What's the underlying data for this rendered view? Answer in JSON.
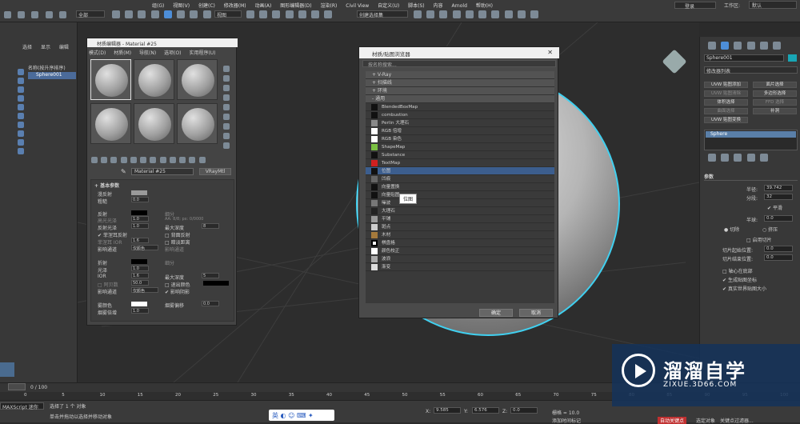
{
  "menubar": {
    "items": [
      "组(G)",
      "视图(V)",
      "创建(C)",
      "修改器(M)",
      "动画(A)",
      "图形编辑器(D)",
      "渲染(R)",
      "Civil View",
      "自定义(U)",
      "脚本(S)",
      "内容",
      "Arnold",
      "帮助(H)"
    ],
    "login": "登录",
    "workspace_label": "工作区:",
    "workspace_value": "默认"
  },
  "toolbar": {
    "filter": "全部",
    "viewmode": "视图",
    "selection_set": "创建选择集"
  },
  "leftpanel": {
    "tabs": [
      "选择",
      "显示",
      "编辑"
    ],
    "tree_header": "名称(按升序排序)",
    "tree_item": "Sphere001"
  },
  "material_editor": {
    "title": "材质编辑器 - Material #25",
    "menu": [
      "模式(D)",
      "材质(M)",
      "导航(N)",
      "选项(O)",
      "实用程序(U)"
    ],
    "material_name": "Material #25",
    "material_type": "VRayMtl",
    "section_basic": "基本参数",
    "rows": [
      {
        "label": "漫反射",
        "value": ""
      },
      {
        "label": "粗糙",
        "value": "0.0"
      },
      {
        "label": "反射",
        "value": ""
      },
      {
        "label": "高光光泽",
        "value": "1.0"
      },
      {
        "label": "反射光泽",
        "value": "1.0"
      },
      {
        "label": "菲涅耳反射",
        "value": ""
      },
      {
        "label": "菲涅耳 IOR",
        "value": "1.6"
      },
      {
        "label": "影响通道",
        "value": "仅颜色"
      },
      {
        "label": "折射",
        "value": ""
      },
      {
        "label": "光泽",
        "value": "1.0"
      },
      {
        "label": "IOR",
        "value": "1.6"
      },
      {
        "label": "阿贝数",
        "value": "50.0"
      },
      {
        "label": "影响通道",
        "value": "仅颜色"
      },
      {
        "label": "雾颜色",
        "value": ""
      },
      {
        "label": "烟雾倍增",
        "value": "1.0"
      }
    ],
    "right_labels": [
      "细分",
      "AA: 8/8; px: 0/0000",
      "最大深度",
      "背面反射",
      "暗淡距离",
      "影响通道",
      "细分",
      "最大深度",
      "退出颜色",
      "影响阴影",
      "烟雾偏移"
    ],
    "right_values": [
      "8",
      "5",
      "5",
      "0.0"
    ]
  },
  "browser": {
    "title": "材质/贴图浏览器",
    "search_placeholder": "按名称搜索...",
    "categories": [
      "+ V-Ray",
      "+ 扫描线",
      "+ 环境",
      "- 通用"
    ],
    "items": [
      "BlendedBoxMap",
      "combustion",
      "Perlin 大理石",
      "RGB 倍增",
      "RGB 染色",
      "ShapeMap",
      "Substance",
      "TextMap",
      "位图",
      "凹痕",
      "向量置换",
      "向量贴图",
      "噪波",
      "大理石",
      "平铺",
      "斑点",
      "木材",
      "棋盘格",
      "颜色校正",
      "波浪",
      "渐变"
    ],
    "selected_index": 8,
    "tooltip": "位图",
    "ok": "确定",
    "cancel": "取消"
  },
  "rightpanel": {
    "object_name": "Sphere001",
    "modifier_list": "修改器列表",
    "buttons": [
      "UVW 贴图添加",
      "面片选择",
      "UVW 贴图清除",
      "多边形选择",
      "体积选择",
      "FFD 选择",
      "曲面选择",
      "补洞",
      "UVW 贴图变换"
    ],
    "stack_item": "Sphere",
    "params_title": "参数",
    "radius_label": "半径:",
    "radius_value": "39.742",
    "segments_label": "分段:",
    "segments_value": "32",
    "smooth_label": "平滑",
    "hemisphere_label": "半球:",
    "hemisphere_value": "0.0",
    "chop_label": "切除",
    "squash_label": "挤压",
    "slice_on_label": "启用切片",
    "slice_from_label": "切片起始位置:",
    "slice_from_value": "0.0",
    "slice_to_label": "切片结束位置:",
    "slice_to_value": "0.0",
    "base_pivot_label": "轴心在底部",
    "gen_coords_label": "生成贴图坐标",
    "real_world_label": "真实世界贴图大小"
  },
  "timeline": {
    "frame": "0 / 100",
    "ticks": [
      "0",
      "5",
      "10",
      "15",
      "20",
      "25",
      "30",
      "35",
      "40",
      "45",
      "50",
      "55",
      "60",
      "65",
      "70",
      "75",
      "80",
      "85",
      "90",
      "95",
      "100"
    ]
  },
  "statusbar": {
    "maxscript": "MAXScript 迷你",
    "selected": "选择了 1 个 对象",
    "hint": "单击并拖动以选择并移动对象",
    "x": "9.585",
    "y": "6.576",
    "z": "0.0",
    "grid": "栅格 = 10.0",
    "add_time_tag": "添加时间标记",
    "autokey": "自动关键点",
    "setkey": "设置关键点",
    "selected_obj": "选定对象",
    "key_filter": "关键点过滤器..."
  },
  "watermark": {
    "cn": "溜溜自学",
    "en": "ZIXUE.3D66.COM"
  },
  "ime": {
    "label": "英"
  }
}
